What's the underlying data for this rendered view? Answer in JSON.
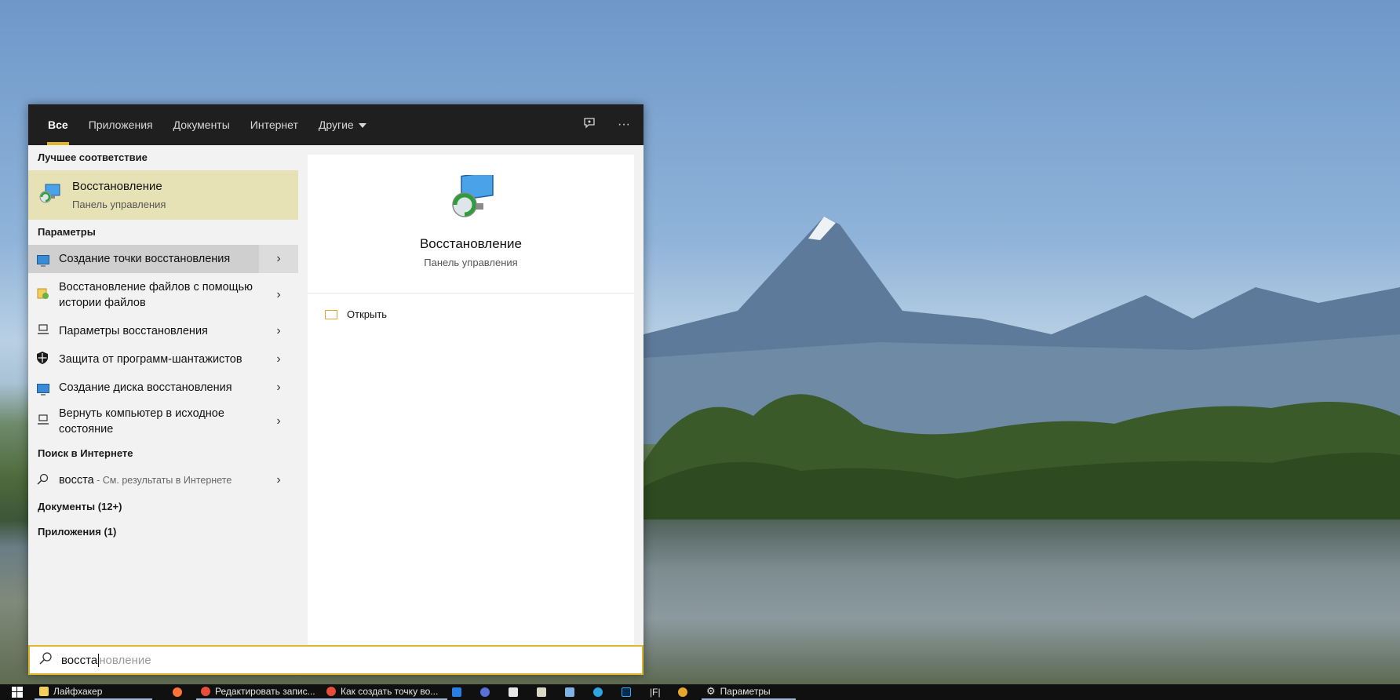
{
  "tabs": [
    "Все",
    "Приложения",
    "Документы",
    "Интернет",
    "Другие"
  ],
  "toolbar": {
    "feedback_icon": "feedback-icon",
    "more_icon": "more-icon",
    "more_label": "···"
  },
  "left": {
    "best_match_header": "Лучшее соответствие",
    "best_match": {
      "title": "Восстановление",
      "subtitle": "Панель управления"
    },
    "settings_header": "Параметры",
    "settings_items": [
      "Создание точки восстановления",
      "Восстановление файлов с помощью истории файлов",
      "Параметры восстановления",
      "Защита от программ-шантажистов",
      "Создание диска восстановления",
      "Вернуть компьютер в исходное состояние"
    ],
    "web_header": "Поиск в Интернете",
    "web_item": {
      "query": "восста",
      "hint": " - См. результаты в Интернете"
    },
    "documents_header": "Документы (12+)",
    "apps_header": "Приложения (1)"
  },
  "right": {
    "title": "Восстановление",
    "subtitle": "Панель управления",
    "action_open": "Открыть"
  },
  "searchbox": {
    "typed": "восста",
    "completion": "новление"
  },
  "taskbar": {
    "items": [
      "Лайфхакер",
      "Редактировать запис...",
      "Как создать точку во...",
      "|F|",
      "Параметры"
    ]
  }
}
